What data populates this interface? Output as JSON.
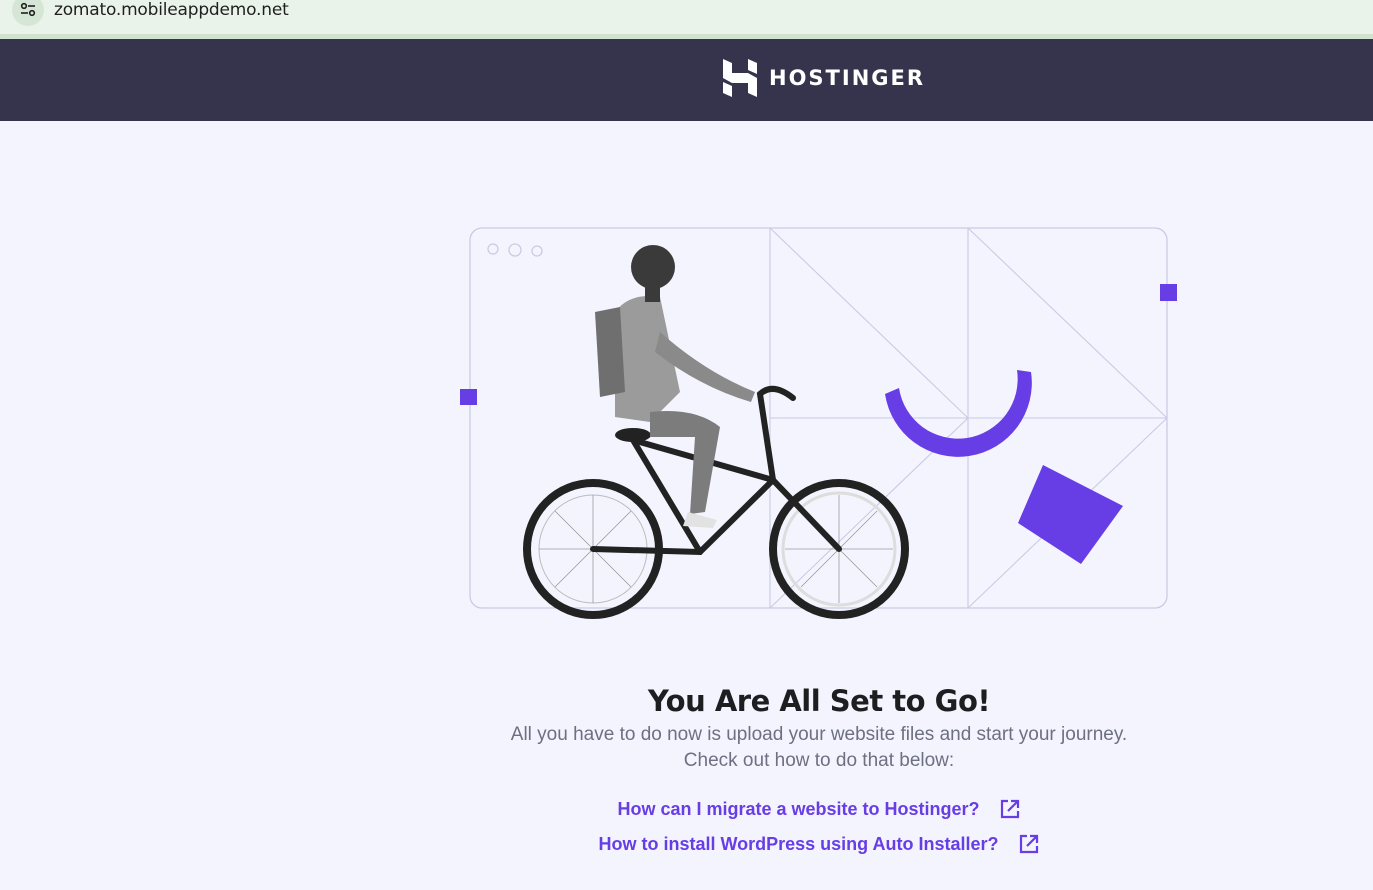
{
  "browser": {
    "url": "zomato.mobileappdemo.net",
    "site_info_icon": "tune-icon"
  },
  "header": {
    "logo_text": "HOSTINGER",
    "logo_icon": "hostinger-h-icon",
    "background": "#36344d"
  },
  "hero": {
    "illustration": "cyclist-on-bicycle",
    "accent_color": "#673de6"
  },
  "main": {
    "title": "You Are All Set to Go!",
    "description_line1": "All you have to do now is upload your website files and start your journey.",
    "description_line2": "Check out how to do that below:",
    "links": [
      {
        "label": "How can I migrate a website to Hostinger?",
        "icon": "external-link-icon"
      },
      {
        "label": "How to install WordPress using Auto Installer?",
        "icon": "external-link-icon"
      }
    ]
  },
  "colors": {
    "page_bg": "#f4f4fe",
    "link": "#673de6",
    "title": "#1d1e20",
    "body_text": "#6d7081"
  }
}
